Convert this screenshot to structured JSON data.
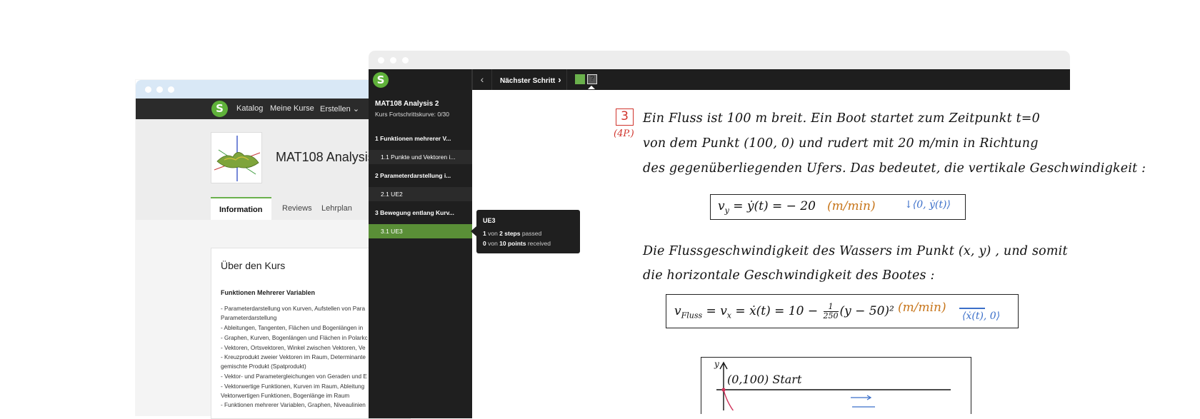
{
  "back_window": {
    "nav": {
      "logo": "S",
      "links": [
        "Katalog",
        "Meine Kurse",
        "Erstellen ⌄"
      ]
    },
    "course_title": "MAT108 Analysis",
    "tabs": [
      "Information",
      "Reviews",
      "Lehrplan"
    ],
    "about": {
      "title": "Über den Kurs",
      "heading": "Funktionen Mehrerer Variablen",
      "lines": [
        "- Parameterdarstellung von Kurven, Aufstellen von Para",
        "Parameterdarstellung",
        "- Ableitungen, Tangenten, Flächen und Bogenlängen in",
        "- Graphen, Kurven, Bogenlängen und Flächen in Polarkc",
        "- Vektoren, Ortsvektoren, Winkel zwischen Vektoren, Ve",
        "- Kreuzprodukt zweier Vektoren im Raum, Determinante",
        "gemischte Produkt (Spatprodukt)",
        "- Vektor- und Parametergleichungen von Geraden und E",
        "- Vektorwertige Funktionen, Kurven im Raum, Ableitung",
        "Vektorwertigen Funktionen, Bogenlänge im Raum",
        "- Funktionen mehrerer Variablen, Graphen, Niveaulinien"
      ]
    }
  },
  "front_window": {
    "logo": "S",
    "prev_label": "‹",
    "next_label": "Nächster Schritt",
    "next_chevron": "›",
    "step_boxes": [
      {
        "state": "passed",
        "color": "#6ab04c"
      },
      {
        "state": "current",
        "color": "#555555",
        "label": "?"
      }
    ],
    "sidebar": {
      "course": "MAT108 Analysis 2",
      "progress": "Kurs Fortschrittskurve:  0/30",
      "items": [
        {
          "label": "1  Funktionen mehrerer V...",
          "type": "section"
        },
        {
          "label": "1.1  Punkte und Vektoren i...",
          "type": "sub"
        },
        {
          "label": "2  Parameterdarstellung i...",
          "type": "section"
        },
        {
          "label": "2.1  UE2",
          "type": "sub"
        },
        {
          "label": "3  Bewegung entlang Kurv...",
          "type": "section"
        },
        {
          "label": "3.1  UE3",
          "type": "sub-active"
        }
      ]
    },
    "tooltip": {
      "title": "UE3",
      "steps_count": "1",
      "steps_mid": " von ",
      "steps_total": "2 steps",
      "steps_suffix": " passed",
      "points_count": "0",
      "points_mid": " von ",
      "points_total": "10 points",
      "points_suffix": " received"
    },
    "content": {
      "task_number": "3",
      "task_points": "(4P.)",
      "text_lines": [
        "Ein  Fluss  ist  100 m  breit.  Ein  Boot  startet  zum Zeitpunkt   t=0",
        "von  dem  Punkt   (100, 0)   und  rudert   mit    20  m/min  in  Richtung",
        "des  gegenüberliegenden  Ufers.  Das bedeutet,  die  vertikale  Geschwindigkeit :"
      ],
      "formula1": {
        "lhs": "v",
        "sub": "y",
        "rhs": " = ẏ(t) = − 20",
        "unit": "(m/min)",
        "vector": "↓⟨0, ẏ(t)⟩"
      },
      "text_lines2": [
        "Die  Flussgeschwindigkeit  des  Wassers  im  Punkt  (x, y) ,  und  somit",
        "die  horizontale  Geschwindigkeit  des  Bootes :"
      ],
      "formula2": {
        "lhs": "v",
        "sub1": "Fluss",
        "mid": " = v",
        "sub2": "x",
        "rhs": " = ẋ(t) =  10 − ",
        "frac_num": "1",
        "frac_den": "250",
        "tail": "(y − 50)²",
        "unit": "(m/min)",
        "vector": "⟨ẋ(t), 0⟩"
      },
      "graph": {
        "axis_label": "y",
        "point_label": "(0,100)  Start"
      }
    }
  }
}
